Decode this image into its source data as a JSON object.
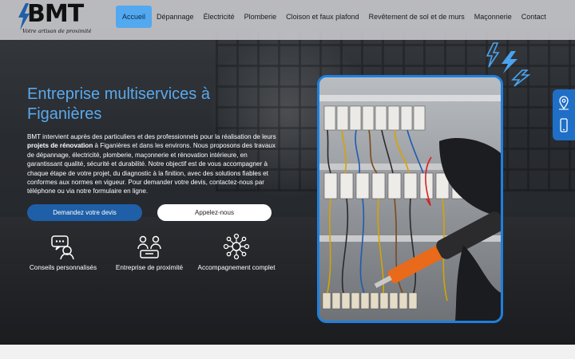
{
  "brand": {
    "logo_text": "BMT",
    "tagline": "Votre artisan de proximité"
  },
  "nav": {
    "items": [
      {
        "label": "Accueil",
        "active": true
      },
      {
        "label": "Dépannage",
        "active": false
      },
      {
        "label": "Électricité",
        "active": false
      },
      {
        "label": "Plomberie",
        "active": false
      },
      {
        "label": "Cloison et faux plafond",
        "active": false
      },
      {
        "label": "Revêtement de sol et de murs",
        "active": false
      },
      {
        "label": "Maçonnerie",
        "active": false
      },
      {
        "label": "Contact",
        "active": false
      }
    ]
  },
  "hero": {
    "title": "Entreprise multiservices à Figanières",
    "text_before": "BMT intervient auprès des particuliers et des professionnels pour la réalisation de leurs ",
    "text_bold": "projets de rénovation",
    "text_after": " à Figanières et dans les environs. Nous proposons des travaux de dépannage, électricité, plomberie, maçonnerie et rénovation intérieure, en garantissant qualité, sécurité et durabilité. Notre objectif est de vous accompagner à chaque étape de votre projet, du diagnostic à la finition, avec des solutions fiables et conformes aux normes en vigueur. Pour demander votre devis, contactez-nous par téléphone ou via notre formulaire en ligne.",
    "primary_button": "Demandez votre devis",
    "secondary_button": "Appelez-nous"
  },
  "features": [
    {
      "label": "Conseils personnalisés",
      "icon": "advice-chat-icon"
    },
    {
      "label": "Entreprise de proximité",
      "icon": "team-proximity-icon"
    },
    {
      "label": "Accompagnement complet",
      "icon": "support-network-icon"
    }
  ],
  "side_tab": {
    "icons": [
      "location-pin-icon",
      "phone-icon"
    ]
  },
  "colors": {
    "accent": "#52a9ef",
    "brand_blue": "#1f5fa8",
    "frame_blue": "#1e7fe0",
    "header_bg": "#d7d7da"
  }
}
